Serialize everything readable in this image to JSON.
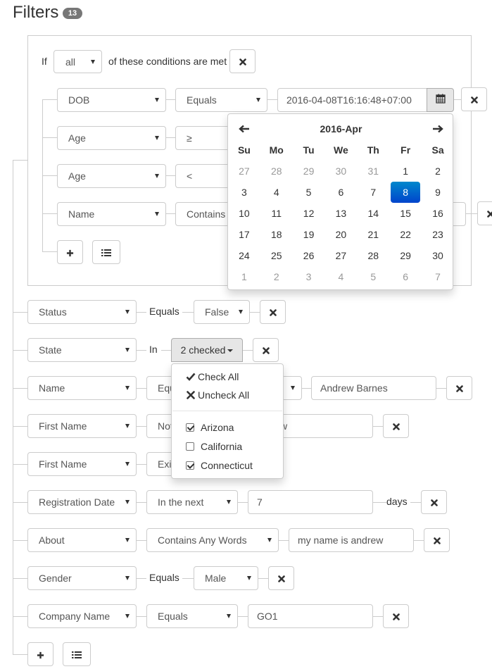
{
  "header": {
    "title": "Filters",
    "badge": "13"
  },
  "group": {
    "prefix": "If",
    "match": "all",
    "suffix": "of these conditions are met",
    "rules": [
      {
        "field": "DOB",
        "operator": "Equals",
        "value": "2016-04-08T16:16:48+07:00"
      },
      {
        "field": "Age",
        "operator": "≥"
      },
      {
        "field": "Age",
        "operator": "<"
      },
      {
        "field": "Name",
        "operator": "Contains"
      }
    ]
  },
  "calendar": {
    "month_label": "2016-Apr",
    "prev": "🡐",
    "next": "🡒",
    "weekdays": [
      "Su",
      "Mo",
      "Tu",
      "We",
      "Th",
      "Fr",
      "Sa"
    ],
    "weeks": [
      [
        "27",
        "28",
        "29",
        "30",
        "31",
        "1",
        "2"
      ],
      [
        "3",
        "4",
        "5",
        "6",
        "7",
        "8",
        "9"
      ],
      [
        "10",
        "11",
        "12",
        "13",
        "14",
        "15",
        "16"
      ],
      [
        "17",
        "18",
        "19",
        "20",
        "21",
        "22",
        "23"
      ],
      [
        "24",
        "25",
        "26",
        "27",
        "28",
        "29",
        "30"
      ],
      [
        "1",
        "2",
        "3",
        "4",
        "5",
        "6",
        "7"
      ]
    ],
    "selected": "8"
  },
  "rules": [
    {
      "field": "Status",
      "operator": "Equals",
      "value": "False"
    },
    {
      "field": "State",
      "operator": "In",
      "value": "2 checked"
    },
    {
      "field": "Name",
      "operator": "Equ",
      "value": "Andrew Barnes"
    },
    {
      "field": "First Name",
      "operator": "Not",
      "value": "w"
    },
    {
      "field": "First Name",
      "operator": "Exi"
    },
    {
      "field": "Registration Date",
      "operator": "In the next",
      "value": "7",
      "unit": "days"
    },
    {
      "field": "About",
      "operator": "Contains Any Words",
      "value": "my name is andrew"
    },
    {
      "field": "Gender",
      "operator": "Equals",
      "value": "Male"
    },
    {
      "field": "Company Name",
      "operator": "Equals",
      "value": "GO1"
    }
  ],
  "state_dropdown": {
    "check_all": "Check All",
    "uncheck_all": "Uncheck All",
    "options": [
      {
        "label": "Arizona",
        "checked": true
      },
      {
        "label": "California",
        "checked": false
      },
      {
        "label": "Connecticut",
        "checked": true
      }
    ]
  },
  "icons": {
    "remove": "remove-icon",
    "add": "plus-icon",
    "group": "list-icon",
    "calendar": "calendar-icon"
  },
  "colors": {
    "border": "#cccccc",
    "selected_day": "#0088cc",
    "muted_day": "#999999",
    "badge": "#777777"
  }
}
